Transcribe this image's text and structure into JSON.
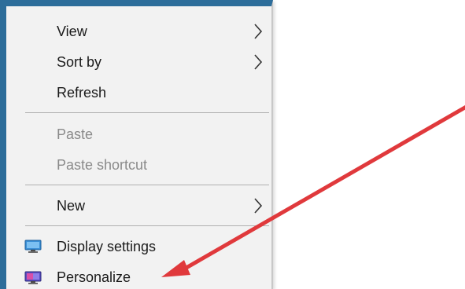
{
  "menu": {
    "items": [
      {
        "label": "View",
        "has_submenu": true,
        "enabled": true
      },
      {
        "label": "Sort by",
        "has_submenu": true,
        "enabled": true
      },
      {
        "label": "Refresh",
        "has_submenu": false,
        "enabled": true
      },
      {
        "label": "Paste",
        "has_submenu": false,
        "enabled": false
      },
      {
        "label": "Paste shortcut",
        "has_submenu": false,
        "enabled": false
      },
      {
        "label": "New",
        "has_submenu": true,
        "enabled": true
      },
      {
        "label": "Display settings",
        "icon": "display-icon",
        "enabled": true
      },
      {
        "label": "Personalize",
        "icon": "personalize-icon",
        "enabled": true
      }
    ]
  },
  "colors": {
    "menu_background": "#f2f2f2",
    "menu_border": "#2d6d9a",
    "disabled_text": "#8a8a8a",
    "arrow": "#e0393c"
  }
}
